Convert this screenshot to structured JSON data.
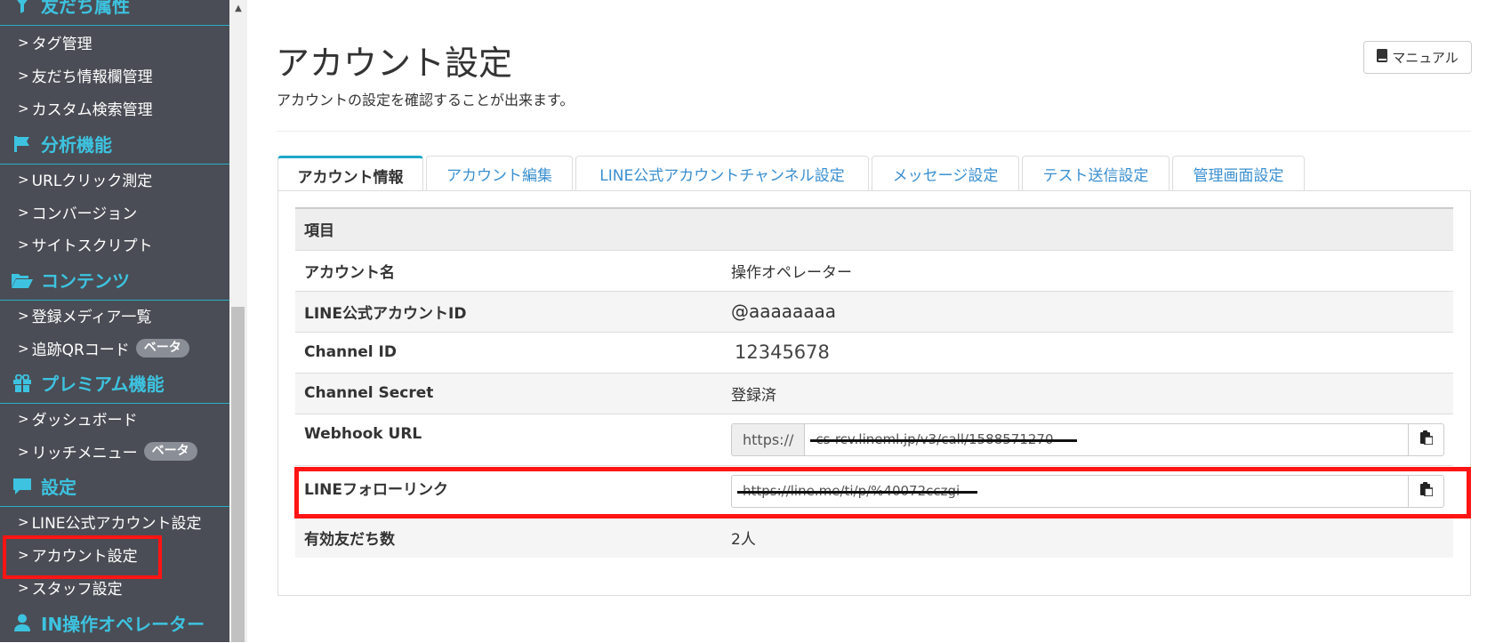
{
  "sidebar": {
    "sections": [
      {
        "title": "友だち属性",
        "icon": "funnel-icon",
        "items": [
          {
            "label": "タグ管理"
          },
          {
            "label": "友だち情報欄管理"
          },
          {
            "label": "カスタム検索管理"
          }
        ]
      },
      {
        "title": "分析機能",
        "icon": "flag-icon",
        "items": [
          {
            "label": "URLクリック測定"
          },
          {
            "label": "コンバージョン"
          },
          {
            "label": "サイトスクリプト"
          }
        ]
      },
      {
        "title": "コンテンツ",
        "icon": "folder-open-icon",
        "items": [
          {
            "label": "登録メディア一覧"
          },
          {
            "label": "追跡QRコード",
            "badge": "ベータ"
          }
        ]
      },
      {
        "title": "プレミアム機能",
        "icon": "gift-icon",
        "items": [
          {
            "label": "ダッシュボード"
          },
          {
            "label": "リッチメニュー",
            "badge": "ベータ"
          }
        ]
      },
      {
        "title": "設定",
        "icon": "comment-icon",
        "items": [
          {
            "label": "LINE公式アカウント設定"
          },
          {
            "label": "アカウント設定",
            "highlighted": true
          },
          {
            "label": "スタッフ設定"
          }
        ]
      },
      {
        "title": "IN操作オペレーター",
        "icon": "user-icon",
        "items": []
      }
    ]
  },
  "header": {
    "title": "アカウント設定",
    "subtitle": "アカウントの設定を確認することが出来ます。",
    "manual_label": "マニュアル"
  },
  "tabs": [
    {
      "label": "アカウント情報",
      "active": true
    },
    {
      "label": "アカウント編集"
    },
    {
      "label": "LINE公式アカウントチャンネル設定"
    },
    {
      "label": "メッセージ設定"
    },
    {
      "label": "テスト送信設定"
    },
    {
      "label": "管理画面設定"
    }
  ],
  "table": {
    "header": "項目",
    "rows": [
      {
        "key": "アカウント名",
        "value": "操作オペレーター"
      },
      {
        "key": "LINE公式アカウントID",
        "value": "@aaaaaaaa"
      },
      {
        "key": "Channel ID",
        "value": "12345678"
      },
      {
        "key": "Channel Secret",
        "value": "登録済"
      },
      {
        "key": "Webhook URL",
        "prefix": "https://",
        "value": "cs-rcv.lineml.jp/v3/call/1588571270"
      },
      {
        "key": "LINEフォローリンク",
        "value": "https://line.me/ti/p/%40072cczgi",
        "highlighted": true
      },
      {
        "key": "有効友だち数",
        "value": "2人"
      }
    ]
  },
  "colors": {
    "sidebar_bg": "#4a4d55",
    "sidebar_accent": "#3dc3e0",
    "highlight_red": "#ff1414",
    "tab_link": "#3a8fd0",
    "tab_active_border": "#1fa8c8"
  }
}
